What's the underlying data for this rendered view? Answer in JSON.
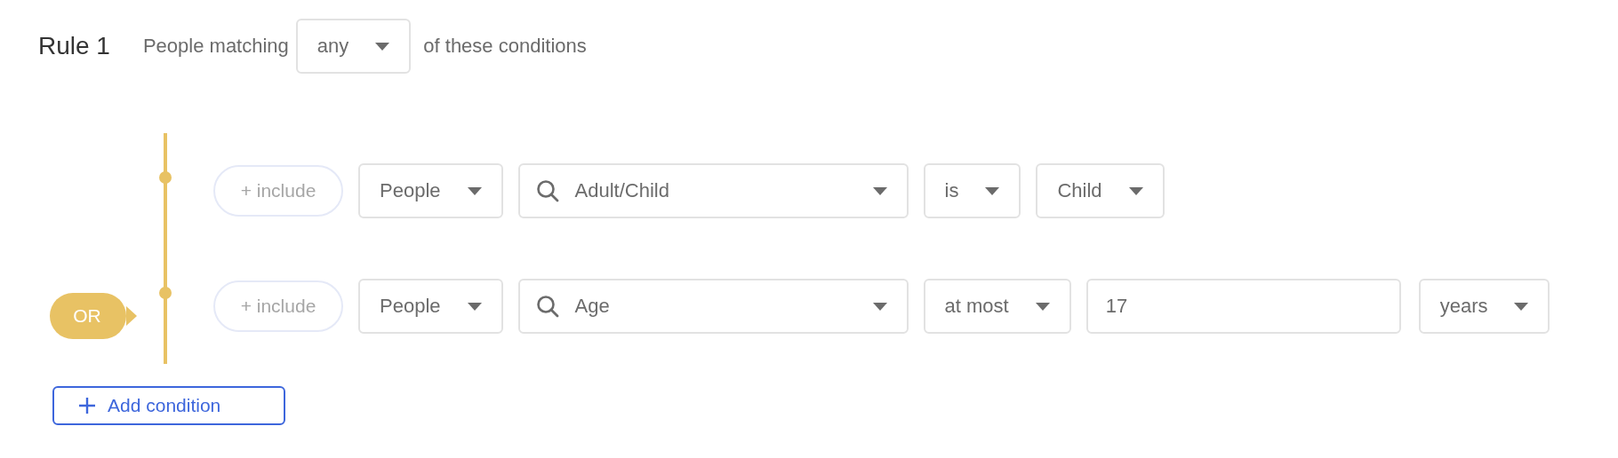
{
  "rule": {
    "title": "Rule 1",
    "prefix": "People matching",
    "match": "any",
    "suffix": "of these conditions"
  },
  "conditions": [
    {
      "include": "+ include",
      "fields": [
        {
          "kind": "dropdown",
          "value": "People"
        },
        {
          "kind": "search",
          "value": "Adult/Child"
        },
        {
          "kind": "dropdown",
          "value": "is"
        },
        {
          "kind": "dropdown",
          "value": "Child"
        }
      ]
    },
    {
      "connector": "OR",
      "include": "+ include",
      "fields": [
        {
          "kind": "dropdown",
          "value": "People"
        },
        {
          "kind": "search",
          "value": "Age"
        },
        {
          "kind": "dropdown",
          "value": "at most"
        },
        {
          "kind": "input",
          "value": "17"
        },
        {
          "kind": "dropdown",
          "value": "years"
        }
      ]
    }
  ],
  "add_button": "Add condition"
}
